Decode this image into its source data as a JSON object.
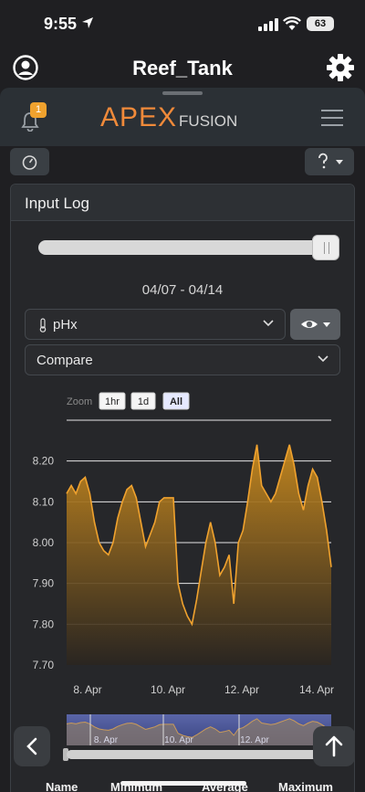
{
  "status": {
    "time": "9:55",
    "battery": "63"
  },
  "header": {
    "title": "Reef_Tank"
  },
  "nav": {
    "badge_count": "1",
    "logo_apex": "APEX",
    "logo_fusion": "FUSION"
  },
  "panel": {
    "title": "Input Log"
  },
  "range": {
    "dates": "04/07 - 04/14",
    "slider_position": 1.0
  },
  "input_select": {
    "value": "pHx"
  },
  "compare_select": {
    "value": "Compare"
  },
  "zoom": {
    "label": "Zoom",
    "options": [
      "1hr",
      "1d",
      "All"
    ],
    "selected": "All"
  },
  "colors": {
    "series": "#f0a22e",
    "background": "#1f1f22",
    "accent": "#f08a3a"
  },
  "chart_data": {
    "type": "area",
    "series": [
      {
        "values": [
          8.12,
          8.14,
          8.12,
          8.15,
          8.16,
          8.12,
          8.05,
          8.0,
          7.98,
          7.97,
          8.0,
          8.06,
          8.1,
          8.13,
          8.14,
          8.11,
          8.05,
          7.99,
          8.02,
          8.05,
          8.1,
          8.11,
          8.11,
          8.11,
          7.9,
          7.85,
          7.82,
          7.8,
          7.86,
          7.93,
          8.0,
          8.05,
          8.0,
          7.92,
          7.94,
          7.97,
          7.85,
          8.0,
          8.03,
          8.1,
          8.18,
          8.24,
          8.14,
          8.12,
          8.1,
          8.12,
          8.16,
          8.2,
          8.24,
          8.19,
          8.12,
          8.08,
          8.14,
          8.18,
          8.16,
          8.1,
          8.03,
          7.94
        ]
      }
    ],
    "x_ticks": [
      "8. Apr",
      "10. Apr",
      "12. Apr",
      "14. Apr"
    ],
    "y_ticks": [
      "8.20",
      "8.10",
      "8.00",
      "7.90",
      "7.80",
      "7.70"
    ],
    "ylim": [
      7.7,
      8.3
    ],
    "grid": true
  },
  "navigator": {
    "labels": [
      "8. Apr",
      "10. Apr",
      "12. Apr"
    ]
  },
  "table": {
    "headers": [
      "Name",
      "Minimum",
      "Average",
      "Maximum"
    ]
  }
}
